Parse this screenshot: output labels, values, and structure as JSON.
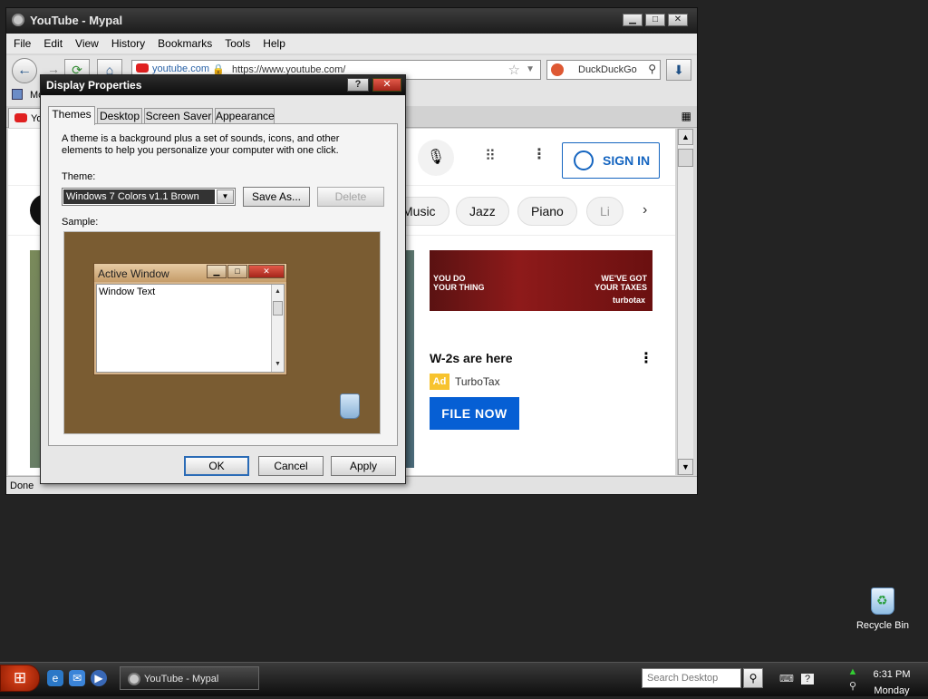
{
  "browser": {
    "title": "YouTube - Mypal",
    "menu": [
      "File",
      "Edit",
      "View",
      "History",
      "Bookmarks",
      "Tools",
      "Help"
    ],
    "url_site": "youtube.com",
    "url": "https://www.youtube.com/",
    "search_engine": "DuckDuckGo",
    "bookmark_label": "Mo",
    "tab_label": "You",
    "status": "Done",
    "youtube": {
      "sign_in": "SIGN IN",
      "chips": [
        "Music",
        "Jazz",
        "Piano",
        "Li"
      ],
      "ad_banner_left": "YOU DO\nYOUR THING",
      "ad_banner_right": "WE'VE GOT\nYOUR TAXES",
      "ad_banner_brand": "turbotax",
      "ad_title": "W-2s are here",
      "ad_badge": "Ad",
      "ad_brand": "TurboTax",
      "ad_cta": "FILE NOW"
    }
  },
  "dialog": {
    "title": "Display Properties",
    "help": "?",
    "close": "✕",
    "tabs": [
      "Themes",
      "Desktop",
      "Screen Saver",
      "Appearance"
    ],
    "description": "A theme is a background plus a set of sounds, icons, and other elements to help you personalize your computer with one click.",
    "theme_label": "Theme:",
    "theme_value": "Windows 7 Colors v1.1 Brown",
    "save_as": "Save As...",
    "delete": "Delete",
    "sample_label": "Sample:",
    "sample_window_title": "Active Window",
    "sample_window_text": "Window Text",
    "ok": "OK",
    "cancel": "Cancel",
    "apply": "Apply"
  },
  "desktop": {
    "recycle_bin": "Recycle Bin"
  },
  "taskbar": {
    "task_label": "YouTube - Mypal",
    "search_placeholder": "Search Desktop",
    "time": "6:31 PM",
    "day": "Monday"
  }
}
